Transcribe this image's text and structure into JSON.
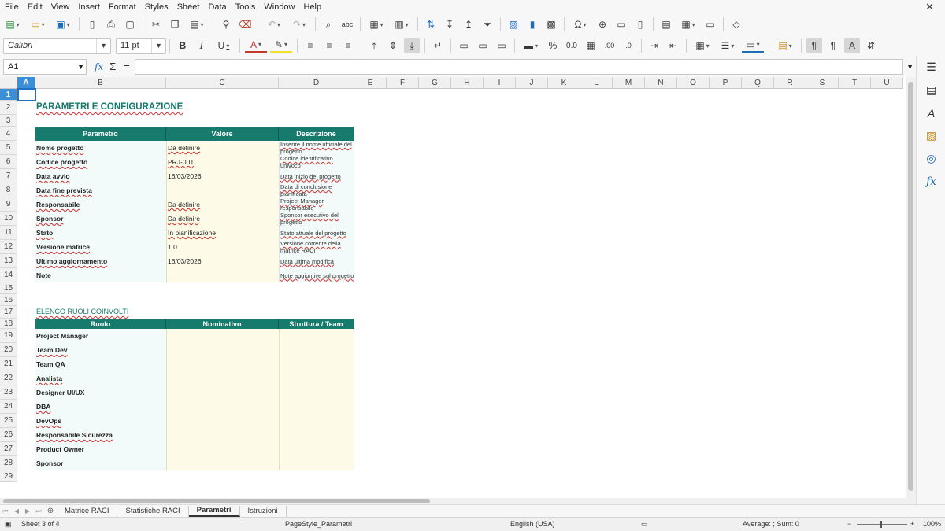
{
  "menu": [
    "File",
    "Edit",
    "View",
    "Insert",
    "Format",
    "Styles",
    "Sheet",
    "Data",
    "Tools",
    "Window",
    "Help"
  ],
  "toolbar": {
    "font_name": "Calibri",
    "font_size": "11 pt"
  },
  "formula_bar": {
    "cell_ref": "A1",
    "fx": "fx",
    "sigma": "Σ",
    "equals": "=",
    "content": ""
  },
  "columns": [
    "A",
    "B",
    "C",
    "D",
    "E",
    "F",
    "G",
    "H",
    "I",
    "J",
    "K",
    "L",
    "M",
    "N",
    "O",
    "P",
    "Q",
    "R",
    "S",
    "T",
    "U"
  ],
  "rows": [
    "1",
    "2",
    "3",
    "4",
    "5",
    "6",
    "7",
    "8",
    "9",
    "10",
    "11",
    "12",
    "13",
    "14",
    "15",
    "16",
    "17",
    "18",
    "19",
    "20",
    "21",
    "22",
    "23",
    "24",
    "25",
    "26",
    "27",
    "28",
    "29"
  ],
  "sheet": {
    "title": "PARAMETRI E CONFIGURAZIONE",
    "params_headers": [
      "Parametro",
      "Valore",
      "Descrizione"
    ],
    "params": [
      {
        "name": "Nome progetto",
        "value": "Da definire",
        "desc": "Inserire il nome ufficiale del progetto"
      },
      {
        "name": "Codice progetto",
        "value": "PRJ-001",
        "desc": "Codice identificativo univoco"
      },
      {
        "name": "Data avvio",
        "value": "16/03/2026",
        "desc": "Data inizio del progetto"
      },
      {
        "name": "Data fine prevista",
        "value": "",
        "desc": "Data di conclusione pianificata"
      },
      {
        "name": "Responsabile",
        "value": "Da definire",
        "desc": "Project Manager responsabile"
      },
      {
        "name": "Sponsor",
        "value": "Da definire",
        "desc": "Sponsor esecutivo del progetto"
      },
      {
        "name": "Stato",
        "value": "In pianificazione",
        "desc": "Stato attuale del progetto"
      },
      {
        "name": "Versione matrice",
        "value": "1.0",
        "desc": "Versione corrente della matrice RACI"
      },
      {
        "name": "Ultimo aggiornamento",
        "value": "16/03/2026",
        "desc": "Data ultima modifica"
      },
      {
        "name": "Note",
        "value": "",
        "desc": "Note aggiuntive sul progetto"
      }
    ],
    "roles_title": "ELENCO RUOLI COINVOLTI",
    "roles_headers": [
      "Ruolo",
      "Nominativo",
      "Struttura / Team"
    ],
    "roles": [
      "Project Manager",
      "Team Dev",
      "Team QA",
      "Analista",
      "Designer UI/UX",
      "DBA",
      "DevOps",
      "Responsabile Sicurezza",
      "Product Owner",
      "Sponsor"
    ]
  },
  "tabs": [
    "Matrice RACI",
    "Statistiche RACI",
    "Parametri",
    "Istruzioni"
  ],
  "active_tab": "Parametri",
  "status": {
    "sheet": "Sheet 3 of 4",
    "page_style": "PageStyle_Parametri",
    "language": "English (USA)",
    "summary": "Average: ; Sum: 0",
    "zoom": "100%"
  }
}
